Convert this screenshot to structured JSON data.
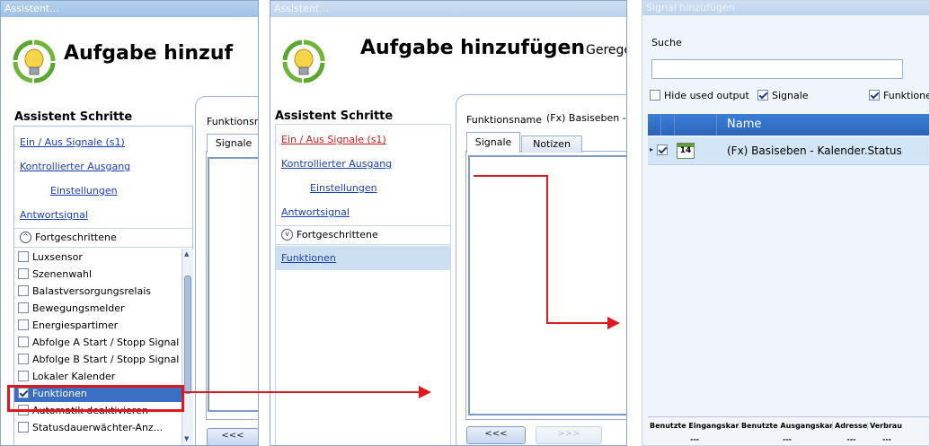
{
  "panel1": {
    "title": "Assistent...",
    "header_title": "Aufgabe hinzuf",
    "steps_title": "Assistent Schritte",
    "links": [
      "Ein / Aus Signale (s1)",
      "Kontrollierter Ausgang",
      "Einstellungen",
      "Antwortsignal"
    ],
    "advanced_label": "Fortgeschrittene",
    "checklist": [
      {
        "label": "Luxsensor",
        "checked": false
      },
      {
        "label": "Szenenwahl",
        "checked": false
      },
      {
        "label": "Balastversorgungsrelais",
        "checked": false
      },
      {
        "label": "Bewegungsmelder",
        "checked": false
      },
      {
        "label": "Energiespartimer",
        "checked": false
      },
      {
        "label": "Abfolge A Start / Stopp Signal",
        "checked": false
      },
      {
        "label": "Abfolge B Start / Stopp Signal",
        "checked": false
      },
      {
        "label": "Lokaler Kalender",
        "checked": false
      },
      {
        "label": "Funktionen",
        "checked": true
      },
      {
        "label": "Automatik deaktivieren",
        "checked": false
      },
      {
        "label": "Statusdauerwächter-Anz...",
        "checked": false
      }
    ],
    "function_label": "Funktionsr",
    "tab_signals": "Signale",
    "back_button": "<<<"
  },
  "panel2": {
    "title": "Assistent...",
    "header_title": "Aufgabe hinzufügen",
    "header_sub": "Gerege",
    "steps_title": "Assistent Schritte",
    "links": [
      "Ein / Aus Signale (s1)",
      "Kontrollierter Ausgang",
      "Einstellungen",
      "Antwortsignal"
    ],
    "advanced_label": "Fortgeschrittene",
    "functions_link": "Funktionen",
    "function_label": "Funktionsname",
    "function_value": "(Fx) Basiseben - I",
    "tab_signals": "Signale",
    "tab_notes": "Notizen",
    "back_button": "<<<",
    "next_button": ">>>"
  },
  "panel3": {
    "title": "Signal hinzufügen",
    "search_label": "Suche",
    "search_value": "",
    "filter_hide_used": "Hide used output",
    "filter_signals": "Signale",
    "filter_functions": "Funktione",
    "column_name": "Name",
    "row": {
      "icon_text": "14",
      "name": "(Fx) Basiseben - Kalender.Status",
      "checked": true
    },
    "footer_columns": [
      "Benutzte Eingangskanäle",
      "Benutzte Ausgangskanäle",
      "Adresse",
      "Verbrau"
    ],
    "footer_values": [
      "---",
      "---",
      "---",
      "---"
    ]
  },
  "colors": {
    "highlight_red": "#e0171f",
    "selection_blue": "#3b6fc4",
    "grid_header_blue": "#2a63b8"
  }
}
